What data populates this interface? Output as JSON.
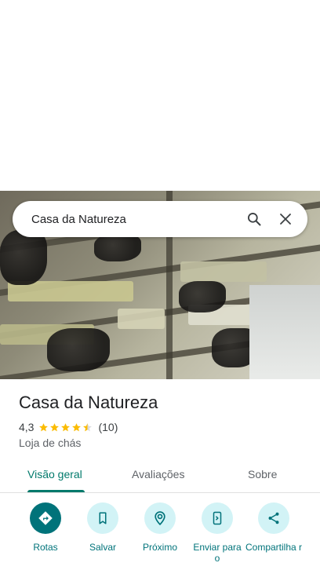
{
  "search": {
    "query": "Casa da Natureza"
  },
  "place": {
    "name": "Casa da Natureza",
    "rating": "4,3",
    "rating_value": 4.3,
    "review_count": "(10)",
    "category": "Loja de chás"
  },
  "tabs": [
    {
      "label": "Visão geral",
      "active": true
    },
    {
      "label": "Avaliações",
      "active": false
    },
    {
      "label": "Sobre",
      "active": false
    }
  ],
  "actions": [
    {
      "label": "Rotas",
      "icon": "directions-icon"
    },
    {
      "label": "Salvar",
      "icon": "bookmark-icon"
    },
    {
      "label": "Próximo",
      "icon": "nearby-icon"
    },
    {
      "label": "Enviar para o",
      "icon": "send-to-phone-icon"
    },
    {
      "label": "Compartilha r",
      "icon": "share-icon"
    }
  ],
  "colors": {
    "accent": "#00737a",
    "tab_active": "#00796b",
    "star": "#fbbc04",
    "action_bg": "#d2f3f6"
  }
}
